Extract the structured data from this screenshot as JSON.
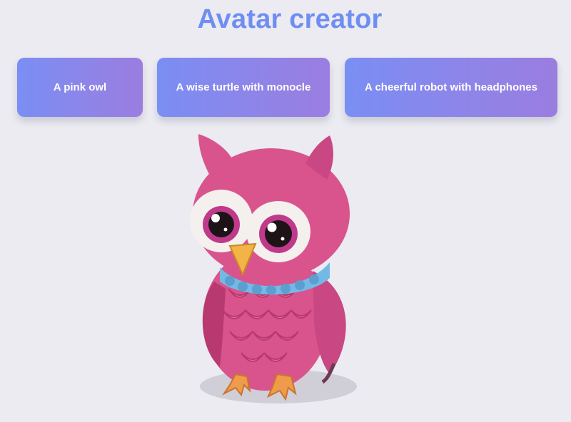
{
  "app": {
    "title": "Avatar creator"
  },
  "prompts": [
    {
      "label": "A pink owl"
    },
    {
      "label": "A wise turtle with monocle"
    },
    {
      "label": "A cheerful robot with headphones"
    }
  ],
  "avatar": {
    "subject": "pink-owl",
    "colors": {
      "body": "#d9548d",
      "body_light": "#e8729f",
      "body_dark": "#b8396f",
      "collar": "#74b9e6",
      "beak": "#f2b447",
      "feet": "#ee9b4c",
      "eye_ring": "#f4f0ee",
      "iris": "#c03a8c"
    }
  },
  "theme": {
    "background": "#ebebf1",
    "title_color": "#6f8ef2",
    "button_gradient_start": "#7a8ef4",
    "button_gradient_end": "#9a7de0"
  }
}
